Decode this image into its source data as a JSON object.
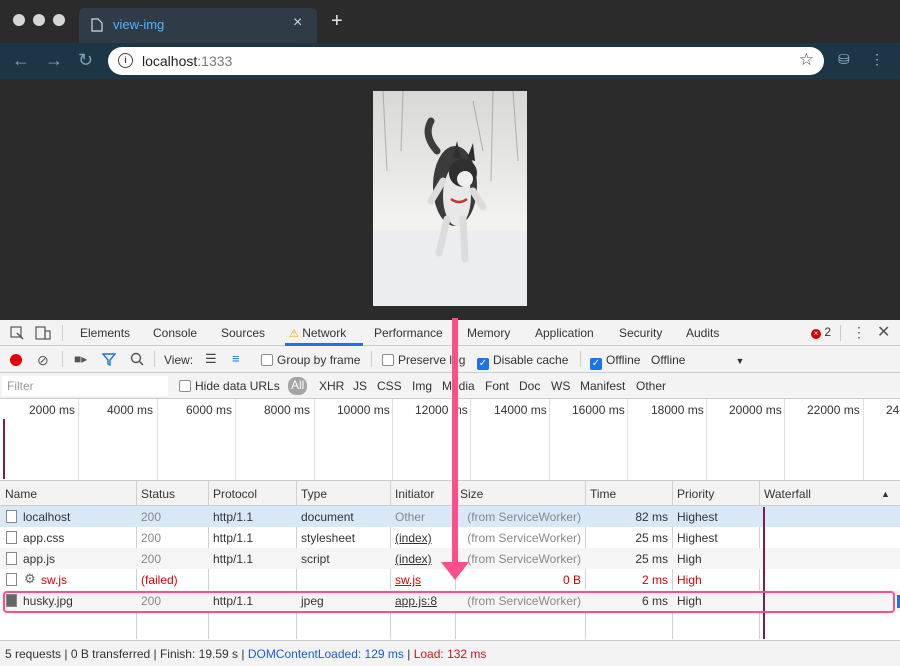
{
  "browser": {
    "tab_title": "view-img",
    "new_tab": "+",
    "address_host": "localhost",
    "address_port": ":1333"
  },
  "devtools": {
    "tabs": [
      "Elements",
      "Console",
      "Sources",
      "Network",
      "Performance",
      "Memory",
      "Application",
      "Security",
      "Audits"
    ],
    "active_tab": "Network",
    "error_count": "2"
  },
  "network_toolbar": {
    "view_label": "View:",
    "group_by_frame": "Group by frame",
    "preserve_log": "Preserve log",
    "disable_cache": "Disable cache",
    "offline": "Offline",
    "throttle_value": "Offline"
  },
  "filter_bar": {
    "placeholder": "Filter",
    "hide_data_urls": "Hide data URLs",
    "types": [
      "All",
      "XHR",
      "JS",
      "CSS",
      "Img",
      "Media",
      "Font",
      "Doc",
      "WS",
      "Manifest",
      "Other"
    ]
  },
  "overview": {
    "ticks": [
      "2000 ms",
      "4000 ms",
      "6000 ms",
      "8000 ms",
      "10000 ms",
      "12000 ms",
      "14000 ms",
      "16000 ms",
      "18000 ms",
      "20000 ms",
      "22000 ms",
      "24"
    ]
  },
  "table": {
    "columns": [
      "Name",
      "Status",
      "Protocol",
      "Type",
      "Initiator",
      "Size",
      "Time",
      "Priority",
      "Waterfall"
    ],
    "rows": [
      {
        "name": "localhost",
        "status": "200",
        "protocol": "http/1.1",
        "type": "document",
        "initiator": "Other",
        "size": "(from ServiceWorker)",
        "time": "82 ms",
        "priority": "Highest"
      },
      {
        "name": "app.css",
        "status": "200",
        "protocol": "http/1.1",
        "type": "stylesheet",
        "initiator": "(index)",
        "size": "(from ServiceWorker)",
        "time": "25 ms",
        "priority": "Highest"
      },
      {
        "name": "app.js",
        "status": "200",
        "protocol": "http/1.1",
        "type": "script",
        "initiator": "(index)",
        "size": "(from ServiceWorker)",
        "time": "25 ms",
        "priority": "High"
      },
      {
        "name": "sw.js",
        "status": "(failed)",
        "protocol": "",
        "type": "",
        "initiator": "sw.js",
        "size": "0 B",
        "time": "2 ms",
        "priority": "High"
      },
      {
        "name": "husky.jpg",
        "status": "200",
        "protocol": "http/1.1",
        "type": "jpeg",
        "initiator": "app.js:8",
        "size": "(from ServiceWorker)",
        "time": "6 ms",
        "priority": "High"
      }
    ]
  },
  "status_bar": {
    "summary": "5 requests | 0 B transferred | Finish: 19.59 s | ",
    "dom_content_loaded": "DOMContentLoaded: 129 ms",
    "separator": " | ",
    "load": "Load: 132 ms"
  },
  "colors": {
    "accent": "#1a73e8",
    "annotation": "#ff4e8c",
    "error": "#d50000"
  }
}
